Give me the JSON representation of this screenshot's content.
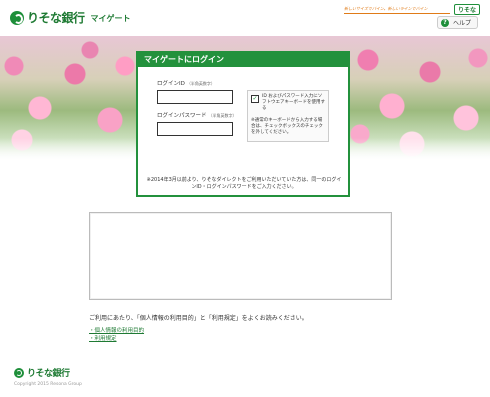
{
  "header": {
    "bank_name": "りそな銀行",
    "service_name": "マイゲート",
    "tagline": "新しいサイズでバイン。新しいラインでバイン",
    "badge": "りそな",
    "help_label": "ヘルプ"
  },
  "login": {
    "title": "マイゲートにログイン",
    "id_label": "ログインID",
    "id_hint": "（半角英数字）",
    "password_label": "ログインパスワード",
    "password_hint": "（半角英数字）",
    "keyboard_option": "ID およびパスワード入力にソフトウエアキーボードを使用する",
    "keyboard_checked": "✓",
    "keyboard_note": "※通常のキーボードから入力する場合は、チェックボックスのチェックを外してください。",
    "notice": "※2014年3月以前より、りそなダイレクトをご利用いただいていた方は、同一のログインID・ログインパスワードをご入力ください。"
  },
  "terms": {
    "agree_text": "ご利用にあたり、「個人情報の利用目的」と「利用規定」をよくお読みください。",
    "links": [
      "個人情報の利用目的",
      "利用規定"
    ]
  },
  "footer": {
    "bank_name": "りそな銀行",
    "copyright": "Copyright 2015 Resona Group"
  }
}
